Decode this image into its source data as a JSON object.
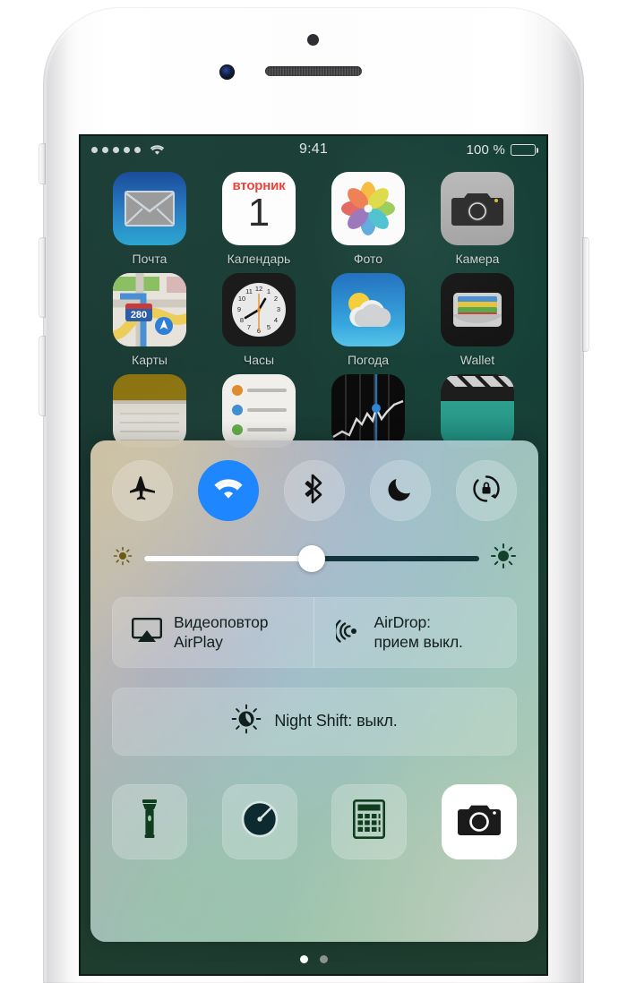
{
  "status_bar": {
    "signal_dots": 5,
    "wifi_icon": "wifi-icon",
    "time": "9:41",
    "battery_percent": "100 %",
    "battery_icon": "battery-full-icon"
  },
  "home_screen": {
    "apps": [
      {
        "label": "Почта",
        "icon": "mail-icon"
      },
      {
        "label": "Календарь",
        "icon": "calendar-icon",
        "day_of_week": "вторник",
        "day_number": "1"
      },
      {
        "label": "Фото",
        "icon": "photos-icon"
      },
      {
        "label": "Камера",
        "icon": "camera-icon"
      },
      {
        "label": "Карты",
        "icon": "maps-icon",
        "route_shield": "280"
      },
      {
        "label": "Часы",
        "icon": "clock-icon"
      },
      {
        "label": "Погода",
        "icon": "weather-icon"
      },
      {
        "label": "Wallet",
        "icon": "wallet-icon"
      },
      {
        "label": "",
        "icon": "notes-icon"
      },
      {
        "label": "",
        "icon": "reminders-icon"
      },
      {
        "label": "",
        "icon": "stocks-icon"
      },
      {
        "label": "",
        "icon": "videos-icon"
      }
    ]
  },
  "control_center": {
    "toggles": [
      {
        "name": "airplane-mode",
        "icon": "airplane-icon",
        "state": "off"
      },
      {
        "name": "wifi",
        "icon": "wifi-icon",
        "state": "on"
      },
      {
        "name": "bluetooth",
        "icon": "bluetooth-icon",
        "state": "off"
      },
      {
        "name": "do-not-disturb",
        "icon": "moon-icon",
        "state": "off"
      },
      {
        "name": "rotation-lock",
        "icon": "rotation-lock-icon",
        "state": "off"
      }
    ],
    "brightness": {
      "value_percent": 50,
      "low_icon": "sun-small-icon",
      "high_icon": "sun-large-icon"
    },
    "airplay": {
      "icon": "airplay-icon",
      "line1": "Видеоповтор",
      "line2": "AirPlay"
    },
    "airdrop": {
      "icon": "airdrop-icon",
      "line1": "AirDrop:",
      "line2": "прием выкл."
    },
    "night_shift": {
      "icon": "night-shift-icon",
      "label": "Night Shift: выкл."
    },
    "shortcuts": [
      {
        "name": "flashlight",
        "icon": "flashlight-icon",
        "active": false
      },
      {
        "name": "timer",
        "icon": "timer-icon",
        "active": false
      },
      {
        "name": "calculator",
        "icon": "calculator-icon",
        "active": false
      },
      {
        "name": "camera",
        "icon": "camera-icon",
        "active": true
      }
    ]
  },
  "page_indicator": {
    "total": 2,
    "active_index": 0
  },
  "colors": {
    "accent_on": "#1e86ff",
    "icon_dark": "#11201c",
    "wallpaper": "#173c34"
  }
}
